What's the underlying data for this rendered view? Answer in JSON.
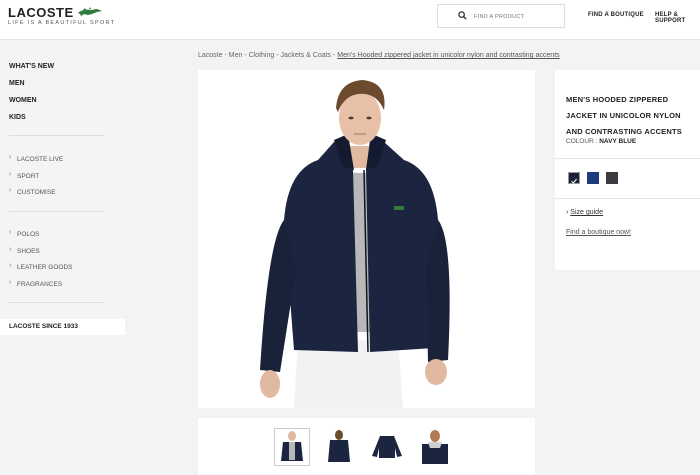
{
  "header": {
    "logo": "LACOSTE",
    "tagline": "LIFE IS A BEAUTIFUL SPORT",
    "search_placeholder": "FIND A PRODUCT",
    "find_boutique": "FIND A BOUTIQUE",
    "help_support": "HELP & SUPPORT"
  },
  "sidebar": {
    "main": [
      "WHAT'S NEW",
      "MEN",
      "WOMEN",
      "KIDS"
    ],
    "group1": [
      "LACOSTE LIVE",
      "SPORT",
      "CUSTOMISE"
    ],
    "group2": [
      "POLOS",
      "SHOES",
      "LEATHER GOODS",
      "FRAGRANCES"
    ],
    "since": "LACOSTE SINCE 1933"
  },
  "breadcrumb": {
    "path": "Lacoste - Men - Clothing - Jackets & Coats - ",
    "current": "Men's Hooded zippered jacket in unicolor nylon and contrasting accents"
  },
  "product": {
    "title": "MEN'S HOODED ZIPPERED JACKET IN UNICOLOR NYLON AND CONTRASTING ACCENTS",
    "colour_label": "COLOUR :",
    "colour_value": "NAVY BLUE",
    "swatches": [
      "#1a2238",
      "#1d3a7a",
      "#3c3c40"
    ],
    "size_guide": "Size guide",
    "find_boutique": "Find a boutique now!"
  },
  "colors": {
    "jacket": "#1c2540",
    "accent": "#2f7a3c"
  }
}
